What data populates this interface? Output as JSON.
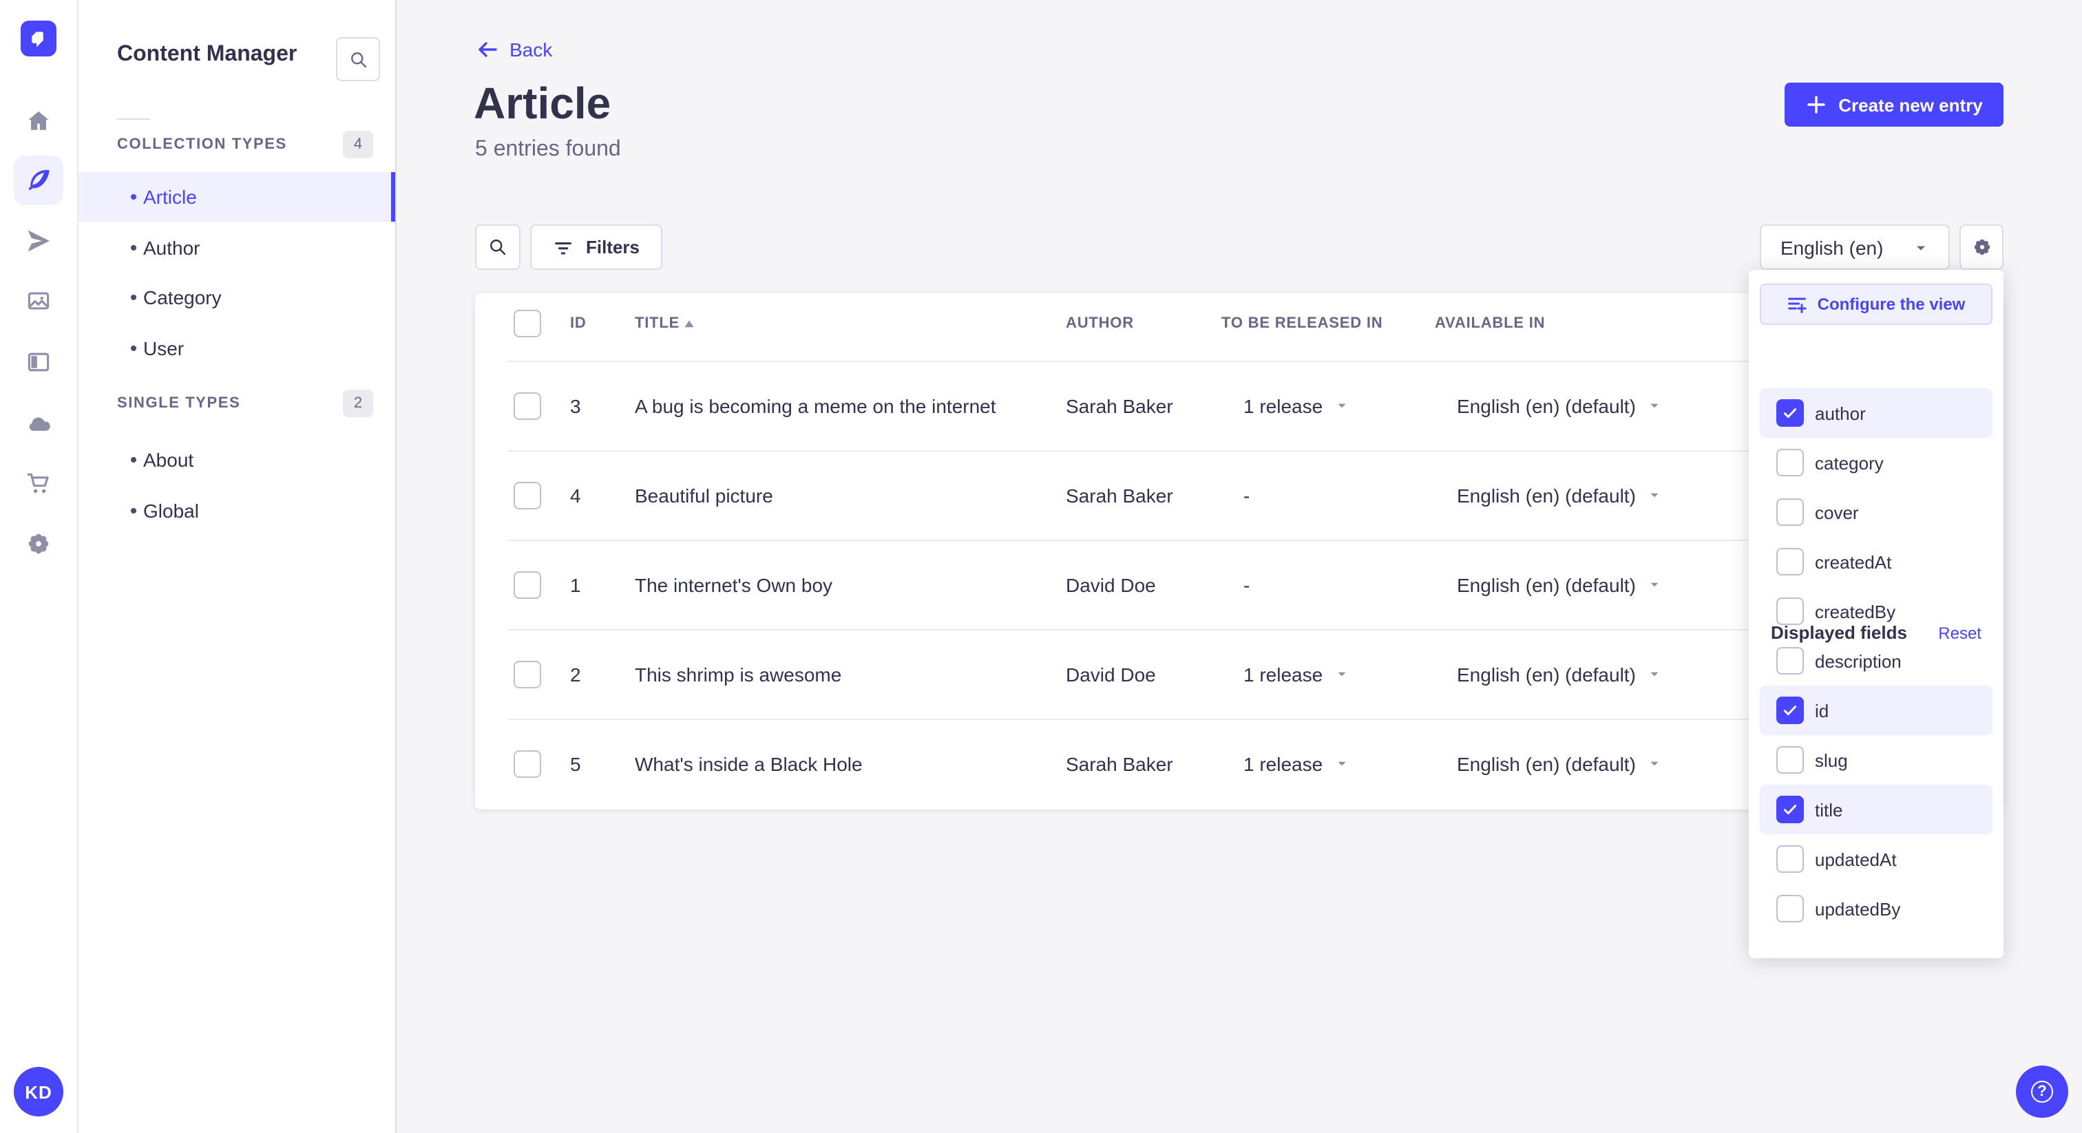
{
  "colors": {
    "accent": "#4945ff",
    "accent_light": "#f0f0ff",
    "text_dark": "#32324d",
    "text_muted": "#666687",
    "icon_gray": "#8e8ea9",
    "page_bg": "#f5f5f8"
  },
  "rail": {
    "icons": [
      "home",
      "content-manager",
      "releases",
      "media-library",
      "content-type-builder",
      "cloud",
      "marketplace",
      "settings"
    ],
    "active_icon": "content-manager",
    "avatar_initials": "KD"
  },
  "sidebar": {
    "title": "Content Manager",
    "sections": [
      {
        "label": "COLLECTION TYPES",
        "count": "4",
        "items": [
          {
            "label": "Article",
            "active": true
          },
          {
            "label": "Author",
            "active": false
          },
          {
            "label": "Category",
            "active": false
          },
          {
            "label": "User",
            "active": false
          }
        ]
      },
      {
        "label": "SINGLE TYPES",
        "count": "2",
        "items": [
          {
            "label": "About",
            "active": false
          },
          {
            "label": "Global",
            "active": false
          }
        ]
      }
    ]
  },
  "header": {
    "back_label": "Back",
    "title": "Article",
    "subtitle": "5 entries found",
    "create_button_label": "Create new entry"
  },
  "toolbar": {
    "filters_label": "Filters",
    "locale_value": "English (en)"
  },
  "table": {
    "columns": [
      "ID",
      "TITLE",
      "AUTHOR",
      "TO BE RELEASED IN",
      "AVAILABLE IN"
    ],
    "sorted_by": "TITLE",
    "sort_direction": "ascending",
    "rows": [
      {
        "id": "3",
        "title": "A bug is becoming a meme on the internet",
        "author": "Sarah Baker",
        "release": "1 release",
        "available": "English (en) (default)"
      },
      {
        "id": "4",
        "title": "Beautiful picture",
        "author": "Sarah Baker",
        "release": "-",
        "available": "English (en) (default)"
      },
      {
        "id": "1",
        "title": "The internet's Own boy",
        "author": "David Doe",
        "release": "-",
        "available": "English (en) (default)"
      },
      {
        "id": "2",
        "title": "This shrimp is awesome",
        "author": "David Doe",
        "release": "1 release",
        "available": "English (en) (default)"
      },
      {
        "id": "5",
        "title": "What's inside a Black Hole",
        "author": "Sarah Baker",
        "release": "1 release",
        "available": "English (en) (default)"
      }
    ]
  },
  "popover": {
    "configure_label": "Configure the view",
    "fields_title": "Displayed fields",
    "reset_label": "Reset",
    "fields": [
      {
        "label": "author",
        "checked": true
      },
      {
        "label": "category",
        "checked": false
      },
      {
        "label": "cover",
        "checked": false
      },
      {
        "label": "createdAt",
        "checked": false
      },
      {
        "label": "createdBy",
        "checked": false
      },
      {
        "label": "description",
        "checked": false
      },
      {
        "label": "id",
        "checked": true
      },
      {
        "label": "slug",
        "checked": false
      },
      {
        "label": "title",
        "checked": true
      },
      {
        "label": "updatedAt",
        "checked": false
      },
      {
        "label": "updatedBy",
        "checked": false
      }
    ]
  }
}
